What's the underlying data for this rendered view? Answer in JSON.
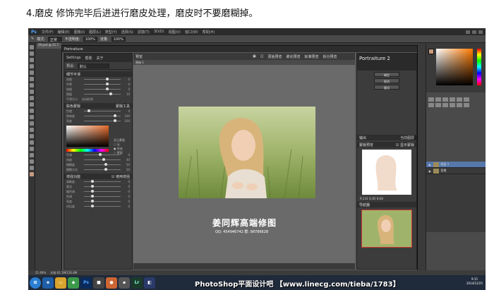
{
  "caption": "4.磨皮 修饰完毕后进进行磨皮处理，磨皮时不要磨糊掉。",
  "ps": {
    "logo": "Ps",
    "menu": [
      "文件(F)",
      "编辑(E)",
      "图像(I)",
      "图层(L)",
      "类型(Y)",
      "选择(S)",
      "滤镜(T)",
      "3D(D)",
      "视图(V)",
      "窗口(W)",
      "帮助(H)"
    ],
    "options": {
      "mode_label": "模式:",
      "mode_value": "正常",
      "opacity_label": "不透明度:",
      "opacity_value": "100%",
      "flow_label": "流量:",
      "flow_value": "100%"
    },
    "doc_tab": "29.psd @ 21.7",
    "zoom_status": "21.69%",
    "doc_status": "文档:62.1M/126.8M",
    "taskbar_text": "PhotoShop平面设计吧 【www.linecg.com/tieba/1783】",
    "time": "9:15",
    "date": "2014/12/25"
  },
  "plugin": {
    "title": "Portraiture",
    "tabs": [
      "Settings",
      "帮助",
      "关于"
    ],
    "preset_label": "预设:",
    "preset_value": "默认",
    "sec1": "细节平滑",
    "sliders1": [
      {
        "label": "较细",
        "value": "0"
      },
      {
        "label": "中等",
        "value": "0"
      },
      {
        "label": "较粗",
        "value": "0"
      },
      {
        "label": "阈值",
        "value": "10"
      },
      {
        "label": "平滑大小",
        "value": "自动检测"
      }
    ],
    "sec2": "肤色蒙版",
    "sec2_right": "蒙版工具",
    "sliders2": [
      {
        "label": "色相",
        "value": "0"
      },
      {
        "label": "饱和度",
        "value": "100"
      },
      {
        "label": "亮度",
        "value": "100"
      }
    ],
    "radios": [
      "显示蒙版",
      "无",
      "所选",
      "蒙版"
    ],
    "sliders3": [
      {
        "label": "色调",
        "value": "0"
      },
      {
        "label": "纬度",
        "value": "40"
      },
      {
        "label": "模糊度",
        "value": "50"
      },
      {
        "label": "模糊方式",
        "value": "50"
      }
    ],
    "sec3": "增强功能",
    "sec3_right": "使用增强",
    "sliders4": [
      {
        "label": "清晰度",
        "value": "0"
      },
      {
        "label": "柔化",
        "value": "0"
      },
      {
        "label": "暖色调",
        "value": "0"
      },
      {
        "label": "色调",
        "value": "0"
      },
      {
        "label": "亮度",
        "value": "0"
      },
      {
        "label": "对比度",
        "value": "0"
      }
    ],
    "center_toolbar": [
      "预览",
      "原始预览",
      "柔化预览",
      "标准预览",
      "拆分预览"
    ],
    "center_tab": "原始 1",
    "watermark": "姜同辉高端修图",
    "qq": "QQ: 454946742   群: 98786628",
    "right_title": "Portraiture 2",
    "right_buttons": [
      "确定",
      "取消",
      "重设"
    ],
    "output_label": "输出",
    "output_value": "当前图层",
    "mask_preview_label": "蒙版预览",
    "mask_checkbox": "显示蒙版",
    "nav_label": "导航器",
    "color_readout": "R:131  G:85  B:68"
  },
  "layers": [
    {
      "name": "图层 1"
    },
    {
      "name": "背景"
    }
  ],
  "colors": {
    "accent": "#4aa3ff",
    "bg": "#3a3a3a",
    "layer_active": "#5577aa"
  }
}
